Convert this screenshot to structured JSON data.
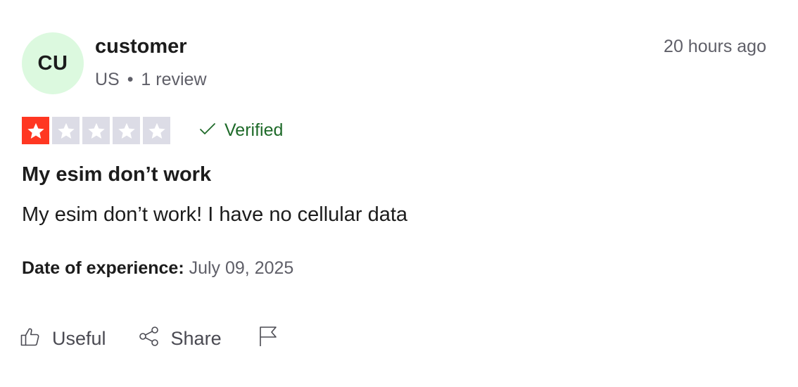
{
  "reviewer": {
    "initials": "CU",
    "name": "customer",
    "country": "US",
    "separator": "•",
    "reviews": "1 review",
    "avatar_color": "#dcf9df"
  },
  "review": {
    "time_ago": "20 hours ago",
    "rating": 1,
    "rating_max": 5,
    "rating_color": "#ff3722",
    "verified_label": "Verified",
    "title": "My esim don’t work",
    "text": "My esim don’t work! I have no cellular data",
    "date_label": "Date of experience:",
    "date_value": "July 09, 2025"
  },
  "actions": {
    "useful_label": "Useful",
    "useful_icon": "thumbs-up-icon",
    "share_label": "Share",
    "share_icon": "share-icon",
    "report_icon": "flag-icon"
  }
}
